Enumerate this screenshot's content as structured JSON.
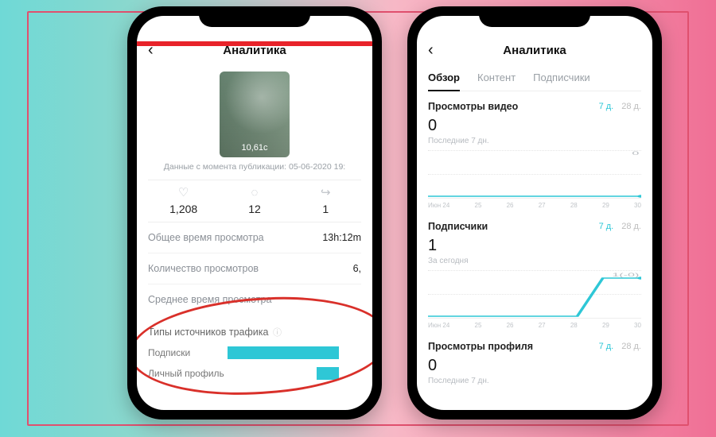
{
  "left": {
    "title": "Аналитика",
    "thumb_duration": "10,61с",
    "caption": "Данные с момента публикации: 05-06-2020 19:",
    "metrics": {
      "likes": "1,208",
      "comments": "12",
      "shares": "1"
    },
    "rows": {
      "total_watch_label": "Общее время просмотра",
      "total_watch_value": "13h:12m",
      "views_label": "Количество просмотров",
      "views_value": "6,",
      "avg_watch_label": "Среднее время просмотра",
      "avg_watch_value": ""
    },
    "traffic": {
      "heading": "Типы источников трафика",
      "subscriptions_label": "Подписки",
      "profile_label": "Личный профиль"
    }
  },
  "right": {
    "title": "Аналитика",
    "tabs": {
      "overview": "Обзор",
      "content": "Контент",
      "followers": "Подписчики"
    },
    "range_7d": "7 д.",
    "range_28d": "28 д.",
    "blocks": {
      "video_views": {
        "name": "Просмотры видео",
        "value": "0",
        "sub": "Последние 7 дн."
      },
      "followers": {
        "name": "Подписчики",
        "value": "1",
        "sub": "За сегодня"
      },
      "profile": {
        "name": "Просмотры профиля",
        "value": "0",
        "sub": "Последние 7 дн."
      }
    },
    "xaxis": [
      "Июн 24",
      "25",
      "26",
      "27",
      "28",
      "29",
      "30"
    ]
  },
  "chart_data": [
    {
      "type": "line",
      "title": "Просмотры видео",
      "categories": [
        "Июн 24",
        "25",
        "26",
        "27",
        "28",
        "29",
        "30"
      ],
      "values": [
        0,
        0,
        0,
        0,
        0,
        0,
        0
      ],
      "ylim": [
        0,
        1
      ]
    },
    {
      "type": "line",
      "title": "Подписчики",
      "categories": [
        "Июн 24",
        "25",
        "26",
        "27",
        "28",
        "29",
        "30"
      ],
      "values": [
        0,
        0,
        0,
        0,
        0,
        1,
        1
      ],
      "ylim": [
        0,
        1
      ]
    },
    {
      "type": "bar",
      "title": "Типы источников трафика",
      "categories": [
        "Подписки",
        "Личный профиль"
      ],
      "values": [
        80,
        15
      ]
    }
  ]
}
